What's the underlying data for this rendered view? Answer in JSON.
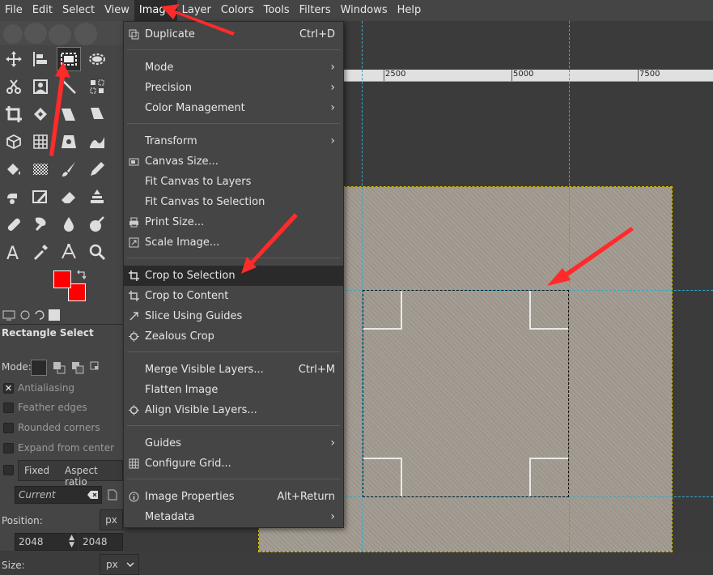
{
  "menubar": {
    "items": [
      "File",
      "Edit",
      "Select",
      "View",
      "Image",
      "Layer",
      "Colors",
      "Tools",
      "Filters",
      "Windows",
      "Help"
    ],
    "active": "Image"
  },
  "image_menu": {
    "duplicate": {
      "label": "Duplicate",
      "shortcut": "Ctrl+D"
    },
    "mode": "Mode",
    "precision": "Precision",
    "color_management": "Color Management",
    "transform": "Transform",
    "canvas_size": "Canvas Size...",
    "fit_canvas_layers": "Fit Canvas to Layers",
    "fit_canvas_selection": "Fit Canvas to Selection",
    "print_size": "Print Size...",
    "scale_image": "Scale Image...",
    "crop_selection": "Crop to Selection",
    "crop_content": "Crop to Content",
    "slice_guides": "Slice Using Guides",
    "zealous_crop": "Zealous Crop",
    "merge_visible": {
      "label": "Merge Visible Layers...",
      "shortcut": "Ctrl+M"
    },
    "flatten": "Flatten Image",
    "align_visible": "Align Visible Layers...",
    "guides": "Guides",
    "configure_grid": "Configure Grid...",
    "image_properties": {
      "label": "Image Properties",
      "shortcut": "Alt+Return"
    },
    "metadata": "Metadata"
  },
  "ruler": {
    "labels": [
      "2500",
      "5000",
      "7500"
    ]
  },
  "tool_options": {
    "title": "Rectangle Select",
    "mode_label": "Mode:",
    "antialiasing": "Antialiasing",
    "feather_edges": "Feather edges",
    "rounded_corners": "Rounded corners",
    "expand_from_center": "Expand from center",
    "fixed": "Fixed",
    "aspect_ratio": "Aspect ratio",
    "current": "Current",
    "position_label": "Position:",
    "position_unit": "px",
    "pos_x": "2048",
    "pos_y": "2048",
    "size_label": "Size:",
    "size_unit": "px"
  },
  "colors": {
    "foreground": "#ff0000",
    "background": "#ff0000",
    "annotation_arrow": "#ff2b2b"
  }
}
